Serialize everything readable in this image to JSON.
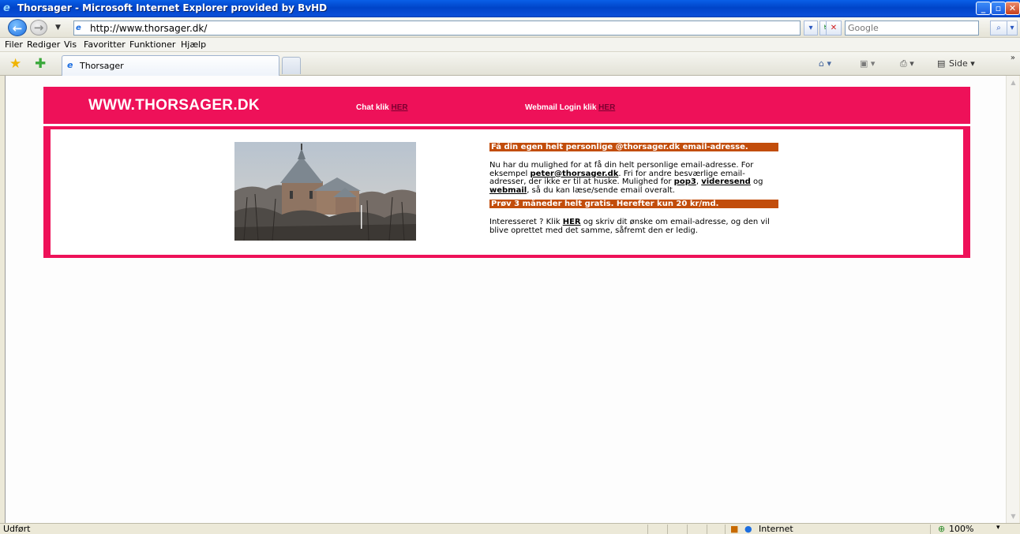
{
  "window": {
    "title": "Thorsager - Microsoft Internet Explorer provided by BvHD"
  },
  "address": {
    "url": "http://www.thorsager.dk/",
    "search_placeholder": "Google"
  },
  "menu": {
    "items": [
      "Filer",
      "Rediger",
      "Vis",
      "Favoritter",
      "Funktioner",
      "Hjælp"
    ]
  },
  "tabs": {
    "active_label": "Thorsager"
  },
  "commandbar": {
    "side_label": "Side"
  },
  "page": {
    "site_title": "WWW.THORSAGER.DK",
    "chat_prefix": "Chat klik ",
    "chat_link": "HER",
    "webmail_prefix": "Webmail Login klik ",
    "webmail_link": "HER",
    "highlight1": "Få din egen helt personlige @thorsager.dk email-adresse.",
    "para1_a": "Nu har du mulighed for at få din helt personlige email-adresse. For eksempel ",
    "para1_email": "peter@thorsager.dk",
    "para1_b": ". Fri for andre besværlige email-adresser, der ikke er til at huske. Mulighed for ",
    "para1_pop3": "pop3",
    "para1_sep": ", ",
    "para1_videresend": "videresend",
    "para1_og": " og ",
    "para1_webmail": "webmail",
    "para1_c": ", så du kan læse/sende email overalt.",
    "highlight2": "Prøv 3 måneder helt gratis. Herefter kun 20 kr/md.",
    "para2_a": "Interesseret ? Klik ",
    "para2_link": "HER",
    "para2_b": " og skriv dit ønske om email-adresse, og den vil blive oprettet med det samme, såfremt den er ledig."
  },
  "status": {
    "left": "Udført",
    "zone": "Internet",
    "zoom": "100%"
  }
}
